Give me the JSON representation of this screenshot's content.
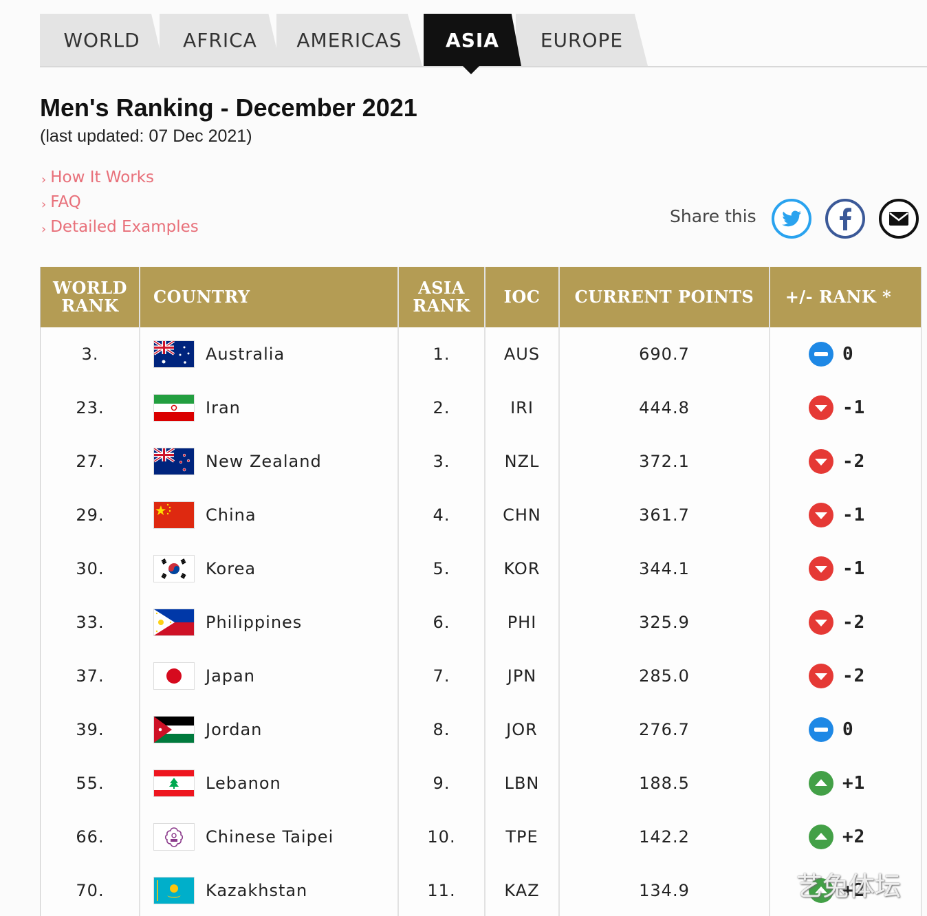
{
  "tabs": [
    {
      "label": "WORLD",
      "active": false
    },
    {
      "label": "AFRICA",
      "active": false
    },
    {
      "label": "AMERICAS",
      "active": false
    },
    {
      "label": "ASIA",
      "active": true
    },
    {
      "label": "EUROPE",
      "active": false
    }
  ],
  "page": {
    "title": "Men's Ranking - December 2021",
    "subtitle": "(last updated: 07 Dec 2021)"
  },
  "links": [
    "How It Works",
    "FAQ",
    "Detailed Examples"
  ],
  "share": {
    "label": "Share this",
    "buttons": [
      {
        "name": "twitter-icon",
        "color": "#2aa3ef"
      },
      {
        "name": "facebook-icon",
        "color": "#3b5998"
      },
      {
        "name": "email-icon",
        "color": "#111111"
      }
    ]
  },
  "table": {
    "headers": {
      "world_rank": "WORLD RANK",
      "country": "COUNTRY",
      "asia_rank": "ASIA RANK",
      "ioc": "IOC",
      "points": "CURRENT POINTS",
      "change": "+/- RANK *"
    },
    "header_color": "#b49c54",
    "rows": [
      {
        "world_rank": "3.",
        "country": "Australia",
        "flag": "australia-flag-icon",
        "asia_rank": "1.",
        "ioc": "AUS",
        "points": "690.7",
        "change": "0",
        "trend": "same"
      },
      {
        "world_rank": "23.",
        "country": "Iran",
        "flag": "iran-flag-icon",
        "asia_rank": "2.",
        "ioc": "IRI",
        "points": "444.8",
        "change": "-1",
        "trend": "down"
      },
      {
        "world_rank": "27.",
        "country": "New Zealand",
        "flag": "new-zealand-flag-icon",
        "asia_rank": "3.",
        "ioc": "NZL",
        "points": "372.1",
        "change": "-2",
        "trend": "down"
      },
      {
        "world_rank": "29.",
        "country": "China",
        "flag": "china-flag-icon",
        "asia_rank": "4.",
        "ioc": "CHN",
        "points": "361.7",
        "change": "-1",
        "trend": "down"
      },
      {
        "world_rank": "30.",
        "country": "Korea",
        "flag": "korea-flag-icon",
        "asia_rank": "5.",
        "ioc": "KOR",
        "points": "344.1",
        "change": "-1",
        "trend": "down"
      },
      {
        "world_rank": "33.",
        "country": "Philippines",
        "flag": "philippines-flag-icon",
        "asia_rank": "6.",
        "ioc": "PHI",
        "points": "325.9",
        "change": "-2",
        "trend": "down"
      },
      {
        "world_rank": "37.",
        "country": "Japan",
        "flag": "japan-flag-icon",
        "asia_rank": "7.",
        "ioc": "JPN",
        "points": "285.0",
        "change": "-2",
        "trend": "down"
      },
      {
        "world_rank": "39.",
        "country": "Jordan",
        "flag": "jordan-flag-icon",
        "asia_rank": "8.",
        "ioc": "JOR",
        "points": "276.7",
        "change": "0",
        "trend": "same"
      },
      {
        "world_rank": "55.",
        "country": "Lebanon",
        "flag": "lebanon-flag-icon",
        "asia_rank": "9.",
        "ioc": "LBN",
        "points": "188.5",
        "change": "+1",
        "trend": "up"
      },
      {
        "world_rank": "66.",
        "country": "Chinese Taipei",
        "flag": "chinese-taipei-flag-icon",
        "asia_rank": "10.",
        "ioc": "TPE",
        "points": "142.2",
        "change": "+2",
        "trend": "up"
      },
      {
        "world_rank": "70.",
        "country": "Kazakhstan",
        "flag": "kazakhstan-flag-icon",
        "asia_rank": "11.",
        "ioc": "KAZ",
        "points": "134.9",
        "change": "+2",
        "trend": "up"
      }
    ]
  },
  "trend_colors": {
    "same": "#1e88e5",
    "down": "#e53935",
    "up": "#43a047"
  },
  "watermark": "艺兔体坛"
}
